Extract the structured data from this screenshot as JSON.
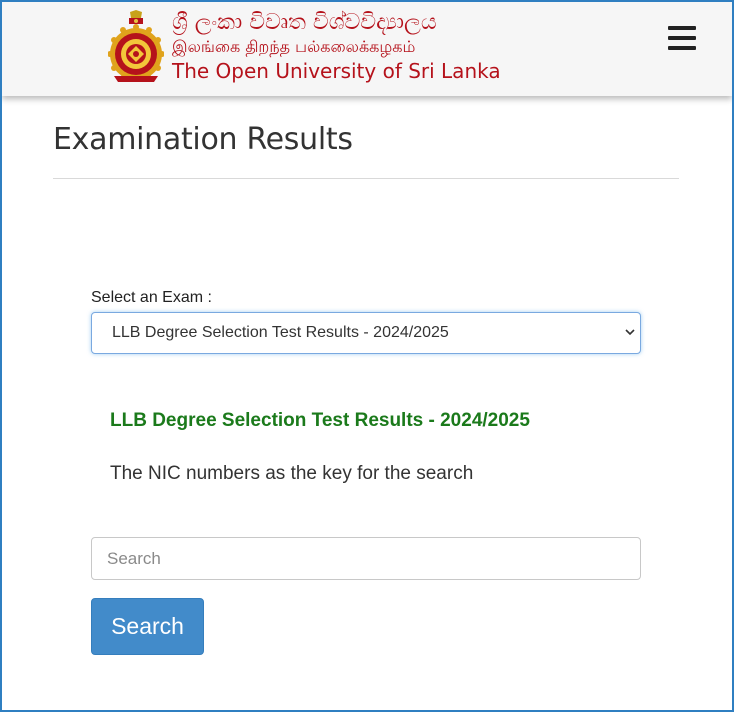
{
  "header": {
    "title_sinhala": "ශ්‍රී ලංකා විවෘත විශ්වවිද්‍යාලය",
    "title_tamil": "இலங்கை திறந்த பல்கலைக்கழகம்",
    "title_english": "The Open University of Sri Lanka",
    "logo_icon": "university-crest-icon",
    "menu_icon": "hamburger-menu-icon"
  },
  "main": {
    "page_title": "Examination Results",
    "select_label": "Select an Exam :",
    "selected_exam": "LLB Degree Selection Test Results - 2024/2025",
    "result_title": "LLB Degree Selection Test Results - 2024/2025",
    "result_note": "The NIC numbers as the key for the search",
    "search_placeholder": "Search",
    "search_value": "",
    "search_button_label": "Search"
  },
  "colors": {
    "brand_red": "#b5121b",
    "result_green": "#1b7a1b",
    "button_blue": "#428bca",
    "frame_blue": "#2f7fc1"
  }
}
